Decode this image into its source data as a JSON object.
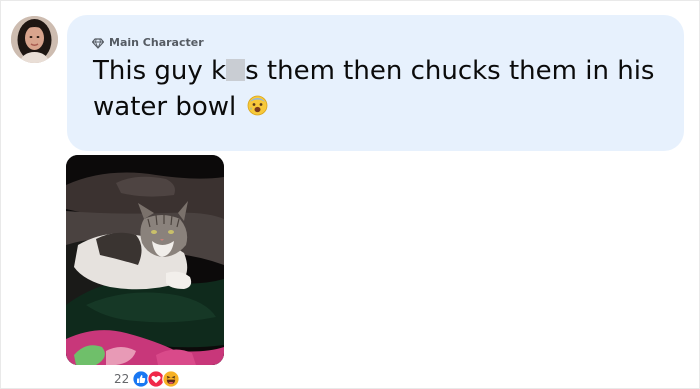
{
  "post": {
    "badge_label": "Main Character",
    "badge_icon": "diamond-icon",
    "text_before": "This guy k",
    "text_after": "s them then chucks them in his water bowl",
    "trailing_emoji": "anxious-face-emoji",
    "colors": {
      "bubble": "#e7f1fd",
      "text": "#0b0b0b",
      "badge": "#555b63",
      "censor": "#c9cdd3"
    }
  },
  "reactions": {
    "count": "22",
    "icons": [
      "like-icon",
      "love-icon",
      "haha-icon"
    ],
    "colors": {
      "like": "#1877f2",
      "love": "#f02849",
      "haha": "#f7b125"
    }
  }
}
